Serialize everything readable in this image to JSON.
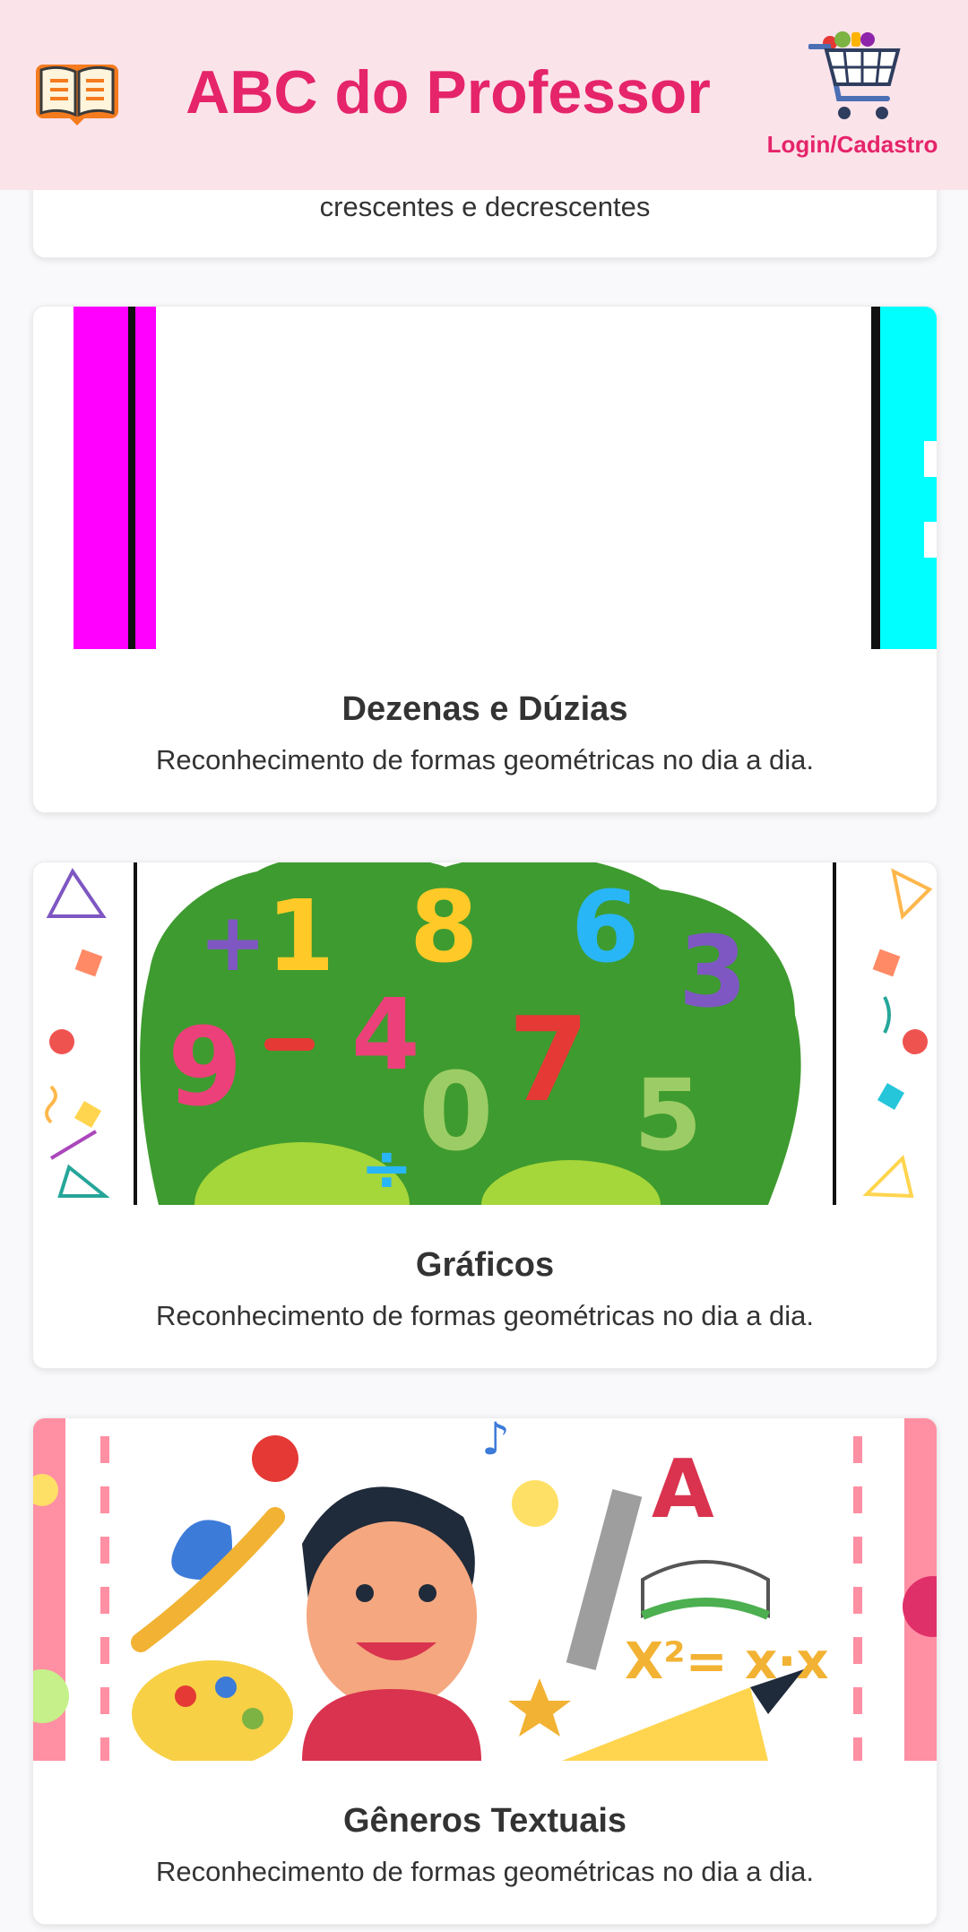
{
  "header": {
    "title": "ABC do Professor",
    "login_label": "Login/Cadastro",
    "logo_icon": "open-book-icon",
    "cart_icon": "shopping-cart-icon"
  },
  "cards": [
    {
      "description": "crescentes e decrescentes"
    },
    {
      "title": "Dezenas e Dúzias",
      "description": "Reconhecimento de formas geométricas no dia a dia."
    },
    {
      "title": "Gráficos",
      "description": "Reconhecimento de formas geométricas no dia a dia."
    },
    {
      "title": "Gêneros Textuais",
      "description": "Reconhecimento de formas geométricas no dia a dia."
    }
  ],
  "colors": {
    "accent": "#e5246a",
    "header_bg": "#fbe3ea",
    "text": "#333333"
  }
}
